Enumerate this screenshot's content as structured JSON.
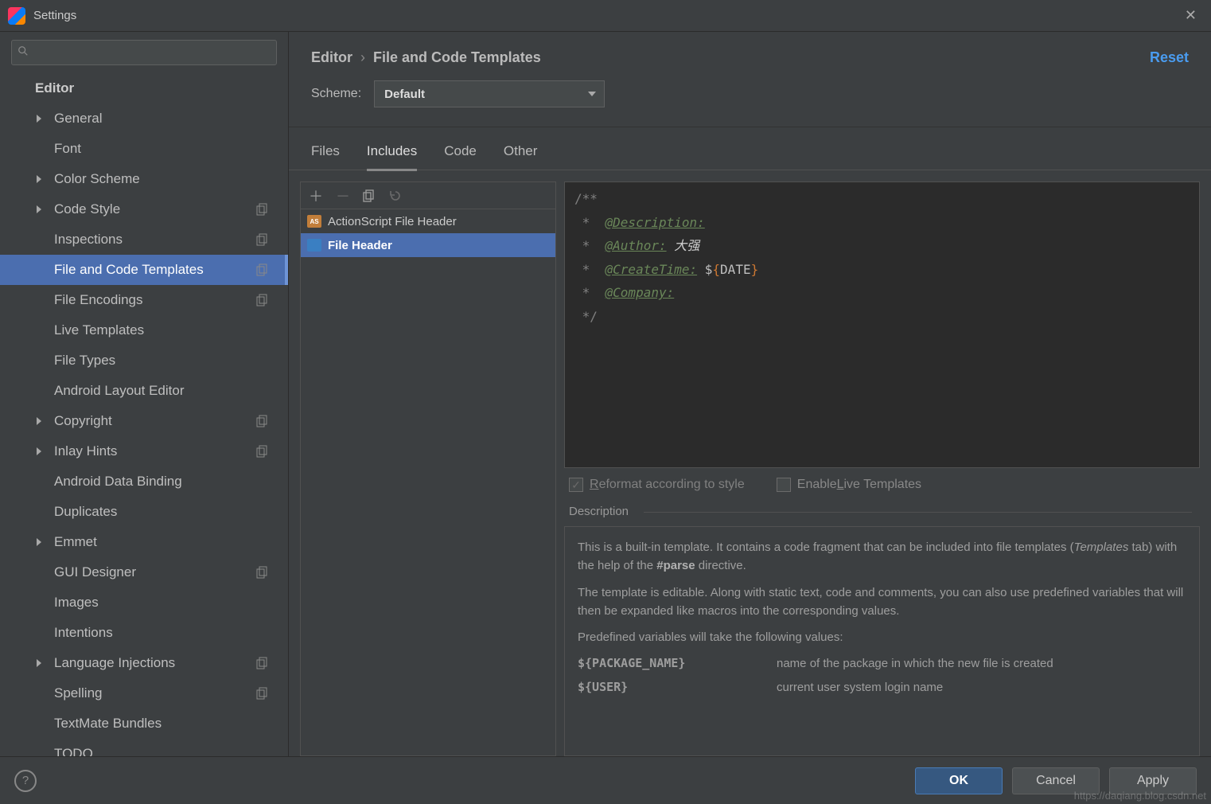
{
  "window": {
    "title": "Settings"
  },
  "search": {
    "placeholder": ""
  },
  "sidebar": {
    "root": "Editor",
    "items": [
      {
        "label": "General",
        "chevron": true,
        "copy": false
      },
      {
        "label": "Font",
        "chevron": false,
        "copy": false
      },
      {
        "label": "Color Scheme",
        "chevron": true,
        "copy": false
      },
      {
        "label": "Code Style",
        "chevron": true,
        "copy": true
      },
      {
        "label": "Inspections",
        "chevron": false,
        "copy": true
      },
      {
        "label": "File and Code Templates",
        "chevron": false,
        "copy": true,
        "selected": true
      },
      {
        "label": "File Encodings",
        "chevron": false,
        "copy": true
      },
      {
        "label": "Live Templates",
        "chevron": false,
        "copy": false
      },
      {
        "label": "File Types",
        "chevron": false,
        "copy": false
      },
      {
        "label": "Android Layout Editor",
        "chevron": false,
        "copy": false
      },
      {
        "label": "Copyright",
        "chevron": true,
        "copy": true
      },
      {
        "label": "Inlay Hints",
        "chevron": true,
        "copy": true
      },
      {
        "label": "Android Data Binding",
        "chevron": false,
        "copy": false
      },
      {
        "label": "Duplicates",
        "chevron": false,
        "copy": false
      },
      {
        "label": "Emmet",
        "chevron": true,
        "copy": false
      },
      {
        "label": "GUI Designer",
        "chevron": false,
        "copy": true
      },
      {
        "label": "Images",
        "chevron": false,
        "copy": false
      },
      {
        "label": "Intentions",
        "chevron": false,
        "copy": false
      },
      {
        "label": "Language Injections",
        "chevron": true,
        "copy": true
      },
      {
        "label": "Spelling",
        "chevron": false,
        "copy": true
      },
      {
        "label": "TextMate Bundles",
        "chevron": false,
        "copy": false
      },
      {
        "label": "TODO",
        "chevron": false,
        "copy": false
      }
    ]
  },
  "breadcrumb": {
    "a": "Editor",
    "b": "File and Code Templates"
  },
  "reset": "Reset",
  "scheme": {
    "label": "Scheme:",
    "value": "Default"
  },
  "tabs": [
    "Files",
    "Includes",
    "Code",
    "Other"
  ],
  "activeTab": 1,
  "templateList": [
    {
      "label": "ActionScript File Header",
      "icon": "as"
    },
    {
      "label": "File Header",
      "icon": "blue",
      "selected": true
    }
  ],
  "editor": {
    "l1": "/**",
    "star": " *  ",
    "desc": "@Description:",
    "auth_tag": "@Author:",
    "auth_val": "大强",
    "ct_tag": "@CreateTime:",
    "ct_dollar": "$",
    "ct_open": "{",
    "ct_var": "DATE",
    "ct_close": "}",
    "comp": "@Company:",
    "end": " */"
  },
  "checks": {
    "reformat_pre": "R",
    "reformat": "eformat according to style",
    "live_pre": "Enable ",
    "live_u": "L",
    "live_post": "ive Templates"
  },
  "desc": {
    "heading": "Description",
    "p1a": "This is a built-in template. It contains a code fragment that can be included into file templates (",
    "p1i": "Templates",
    "p1b": " tab) with the help of the ",
    "p1bold": "#parse",
    "p1c": " directive.",
    "p2": "The template is editable. Along with static text, code and comments, you can also use predefined variables that will then be expanded like macros into the corresponding values.",
    "p3": "Predefined variables will take the following values:",
    "vars": [
      {
        "k": "${PACKAGE_NAME}",
        "v": "name of the package in which the new file is created"
      },
      {
        "k": "${USER}",
        "v": "current user system login name"
      }
    ]
  },
  "footer": {
    "ok": "OK",
    "cancel": "Cancel",
    "apply": "Apply"
  },
  "watermark": "https://daqiang.blog.csdn.net"
}
